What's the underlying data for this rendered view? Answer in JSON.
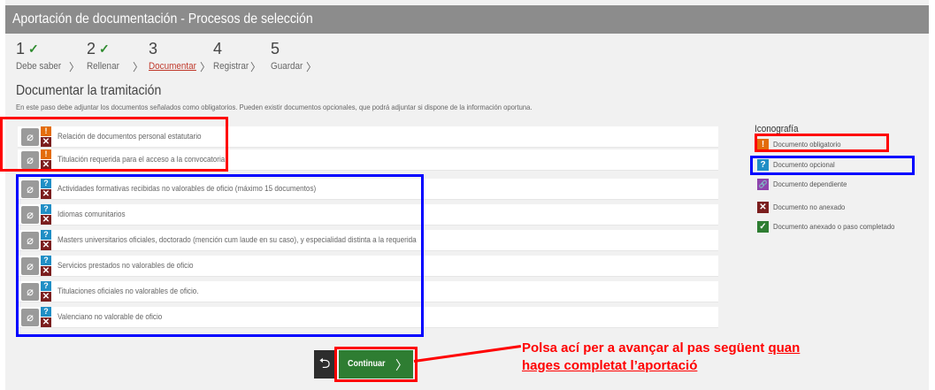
{
  "window": {
    "title": "Aportación de documentación - Procesos de selección"
  },
  "steps": [
    {
      "number": "1",
      "label": "Debe saber",
      "done": true
    },
    {
      "number": "2",
      "label": "Rellenar",
      "done": true
    },
    {
      "number": "3",
      "label": "Documentar",
      "done": false,
      "active": true
    },
    {
      "number": "4",
      "label": "Registrar",
      "done": false
    },
    {
      "number": "5",
      "label": "Guardar",
      "done": false
    }
  ],
  "step_check": "✓",
  "step_arrow": "〉",
  "section": {
    "title": "Documentar la tramitación",
    "description": "En este paso debe adjuntar los documentos señalados como obligatorios. Pueden existir documentos opcionales, que podrá adjuntar si dispone de la información oportuna."
  },
  "documents": [
    {
      "label": "Relación de documentos personal estatutario",
      "type": "obligatorio"
    },
    {
      "label": "Titulación requerida para el acceso a la convocatoria",
      "type": "obligatorio"
    },
    {
      "label": "Actividades formativas recibidas no valorables de oficio (máximo 15 documentos)",
      "type": "opcional"
    },
    {
      "label": "Idiomas comunitarios",
      "type": "opcional"
    },
    {
      "label": "Masters universitarios oficiales, doctorado (mención cum laude en su caso), y especialidad distinta a la requerida",
      "type": "opcional"
    },
    {
      "label": "Servicios prestados no valorables de oficio",
      "type": "opcional"
    },
    {
      "label": "Titulaciones oficiales no valorables de oficio.",
      "type": "opcional"
    },
    {
      "label": "Valenciano no valorable de oficio",
      "type": "opcional"
    }
  ],
  "legend": {
    "title": "Iconografía",
    "items": [
      {
        "label": "Documento obligatorio",
        "icon": "!",
        "color": "#e36c0a"
      },
      {
        "label": "Documento opcional",
        "icon": "?",
        "color": "#1f8ec5"
      },
      {
        "label": "Documento dependiente",
        "icon": "🔗",
        "color": "#8e44ad"
      },
      {
        "label": "Documento no anexado",
        "icon": "✕",
        "color": "#7b1e1e"
      },
      {
        "label": "Documento anexado o paso completado",
        "icon": "✓",
        "color": "#2e7d32"
      }
    ]
  },
  "buttons": {
    "back_icon": "⮌",
    "continue_label": "Continuar",
    "continue_arrow": "〉"
  },
  "callout": {
    "line1": "Polsa ací per a avançar al pas següent ",
    "line1_underlined": "quan",
    "line2": "hages completat l’aportació"
  },
  "colors": {
    "highlight_red": "#ff0000",
    "highlight_blue": "#0000ff",
    "accent_active": "#c0392b"
  }
}
